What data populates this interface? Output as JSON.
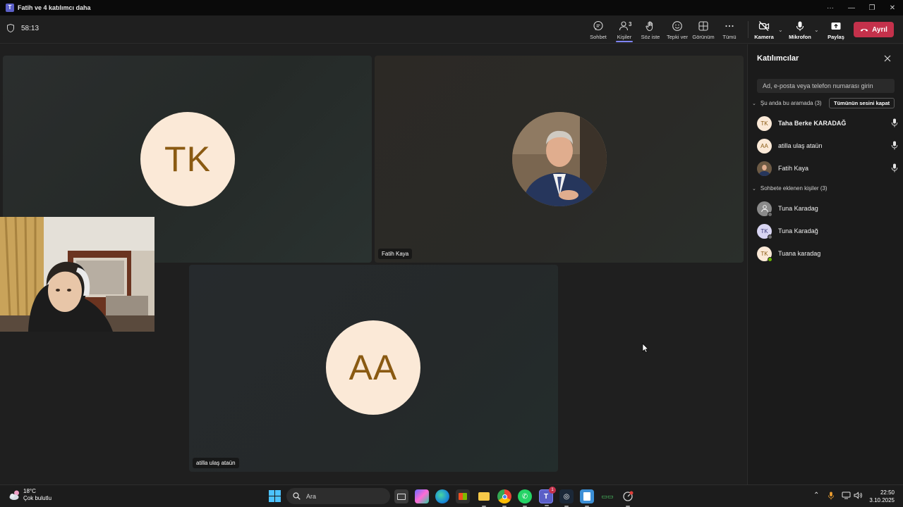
{
  "window": {
    "title": "Fatih ve 4 katılımcı daha"
  },
  "toolbar": {
    "timer": "58:13",
    "chat_label": "Sohbet",
    "people_label": "Kişiler",
    "people_count": "3",
    "raise_hand_label": "Söz iste",
    "react_label": "Tepki ver",
    "view_label": "Görünüm",
    "more_label": "Tümü",
    "camera_label": "Kamera",
    "mic_label": "Mikrofon",
    "share_label": "Paylaş",
    "leave_label": "Ayrıl",
    "leave_color": "#c4314b"
  },
  "stage": {
    "tiles": [
      {
        "initials": "TK",
        "name": ""
      },
      {
        "initials": "",
        "name": "Fatih Kaya"
      },
      {
        "initials": "AA",
        "name": "atilla ulaş ataün"
      }
    ]
  },
  "panel": {
    "title": "Katılımcılar",
    "search_placeholder": "Ad, e-posta veya telefon numarası girin",
    "in_call_header": "Şu anda bu aramada (3)",
    "mute_all_label": "Tümünün sesini kapat",
    "in_call": [
      {
        "initials": "TK",
        "name": "Taha Berke KARADAĞ"
      },
      {
        "initials": "AA",
        "name": "atilla ulaş ataün"
      },
      {
        "initials": "",
        "name": "Fatih Kaya"
      }
    ],
    "chat_added_header": "Sohbete eklenen kişiler (3)",
    "chat_added": [
      {
        "initials": "",
        "name": "Tuna Karadag"
      },
      {
        "initials": "TK",
        "name": "Tuna Karadağ"
      },
      {
        "initials": "TK",
        "name": "Tuana karadag"
      }
    ]
  },
  "taskbar": {
    "weather_temp": "18°C",
    "weather_desc": "Çok bulutlu",
    "search_label": "Ara",
    "teams_badge": "1",
    "time": "22:50",
    "date": "3.10.2025"
  }
}
